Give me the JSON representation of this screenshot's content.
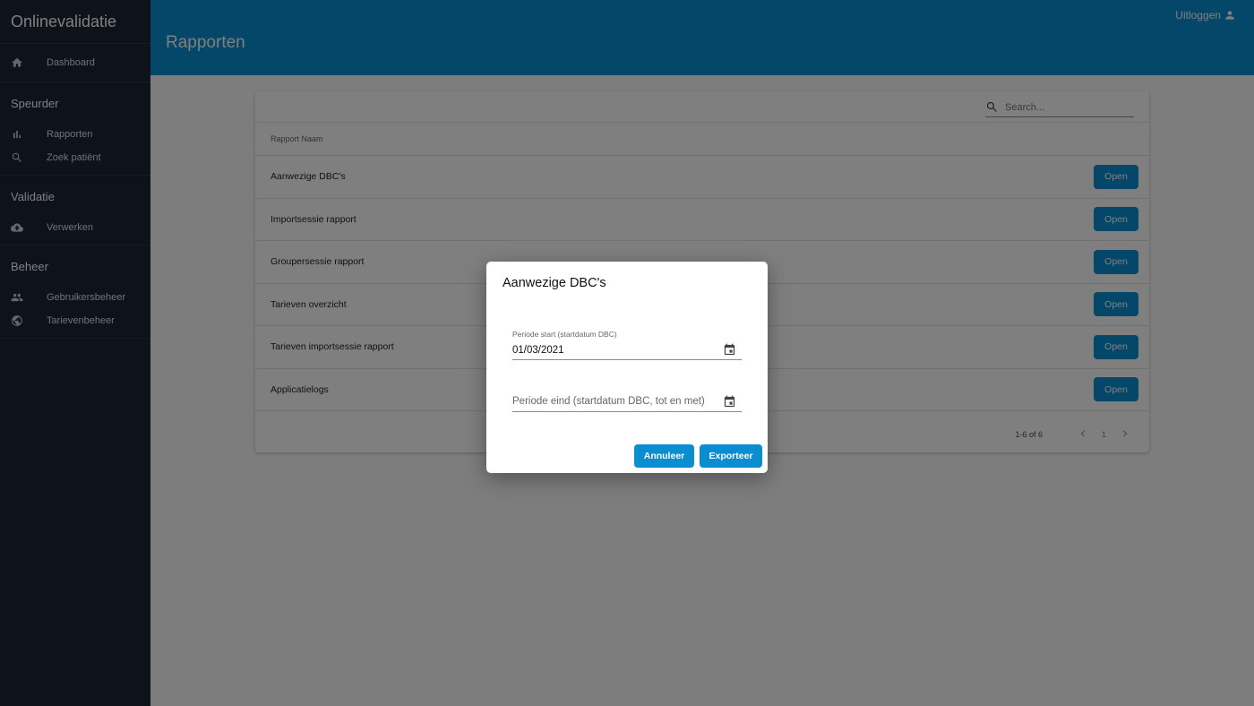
{
  "app": {
    "title": "Onlinevalidatie"
  },
  "sidebar": {
    "dashboard": {
      "label": "Dashboard",
      "icon": "home-icon"
    },
    "sections": [
      {
        "title": "Speurder",
        "items": [
          {
            "label": "Rapporten",
            "icon": "bar-chart-icon"
          },
          {
            "label": "Zoek patiënt",
            "icon": "search-icon"
          }
        ]
      },
      {
        "title": "Validatie",
        "items": [
          {
            "label": "Verwerken",
            "icon": "cloud-upload-icon"
          }
        ]
      },
      {
        "title": "Beheer",
        "items": [
          {
            "label": "Gebruikersbeheer",
            "icon": "people-icon"
          },
          {
            "label": "Tarievenbeheer",
            "icon": "globe-icon"
          }
        ]
      }
    ]
  },
  "header": {
    "title": "Rapporten",
    "logout_label": "Uitloggen"
  },
  "search": {
    "placeholder": "Search..."
  },
  "table": {
    "column": "Rapport Naam",
    "open_label": "Open",
    "rows": [
      "Aanwezige DBC's",
      "Importsessie rapport",
      "Groupersessie rapport",
      "Tarieven overzicht",
      "Tarieven importsessie rapport",
      "Applicatielogs"
    ],
    "pagination": {
      "range": "1-6 of 6",
      "page": "1"
    }
  },
  "dialog": {
    "title": "Aanwezige DBC's",
    "start_label": "Periode start (startdatum DBC)",
    "start_value": "01/03/2021",
    "end_placeholder": "Periode eind (startdatum DBC, tot en met)",
    "cancel_label": "Annuleer",
    "export_label": "Exporteer"
  },
  "colors": {
    "primary": "#0a8ed1",
    "sidebar": "#1b2436"
  }
}
